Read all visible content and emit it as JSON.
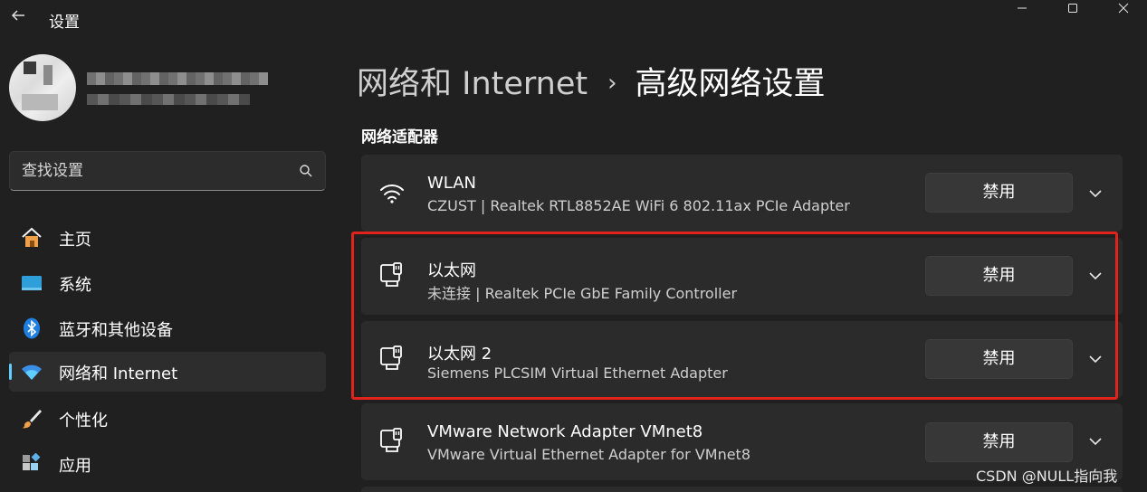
{
  "window": {
    "title": "设置",
    "back_icon": "back-arrow-icon",
    "controls": [
      "minimize-icon",
      "maximize-icon",
      "close-icon"
    ]
  },
  "search": {
    "placeholder": "查找设置",
    "icon": "search-icon"
  },
  "sidebar": {
    "items": [
      {
        "label": "主页",
        "icon": "home-icon",
        "active": false
      },
      {
        "label": "系统",
        "icon": "system-display-icon",
        "active": false
      },
      {
        "label": "蓝牙和其他设备",
        "icon": "bluetooth-icon",
        "active": false
      },
      {
        "label": "网络和 Internet",
        "icon": "wifi-icon",
        "active": true
      },
      {
        "label": "个性化",
        "icon": "paintbrush-icon",
        "active": false
      },
      {
        "label": "应用",
        "icon": "apps-icon",
        "active": false
      }
    ]
  },
  "header": {
    "parent": "网络和 Internet",
    "separator": "›",
    "current": "高级网络设置"
  },
  "section": {
    "title": "网络适配器"
  },
  "adapters": [
    {
      "name": "WLAN",
      "description": "CZUST | Realtek RTL8852AE WiFi 6 802.11ax PCIe Adapter",
      "icon": "wifi-icon",
      "button": "禁用"
    },
    {
      "name": "以太网",
      "description": "未连接 | Realtek PCIe GbE Family Controller",
      "icon": "ethernet-icon",
      "button": "禁用"
    },
    {
      "name": "以太网 2",
      "description": "Siemens PLCSIM Virtual Ethernet Adapter",
      "icon": "ethernet-icon",
      "button": "禁用"
    },
    {
      "name": "VMware Network Adapter VMnet8",
      "description": "VMware Virtual Ethernet Adapter for VMnet8",
      "icon": "ethernet-icon",
      "button": "禁用"
    }
  ],
  "watermark": "CSDN @NULL指向我",
  "colors": {
    "background": "#202020",
    "card": "#2b2b2b",
    "accent": "#60cdff",
    "highlight_border": "#e0241c"
  }
}
